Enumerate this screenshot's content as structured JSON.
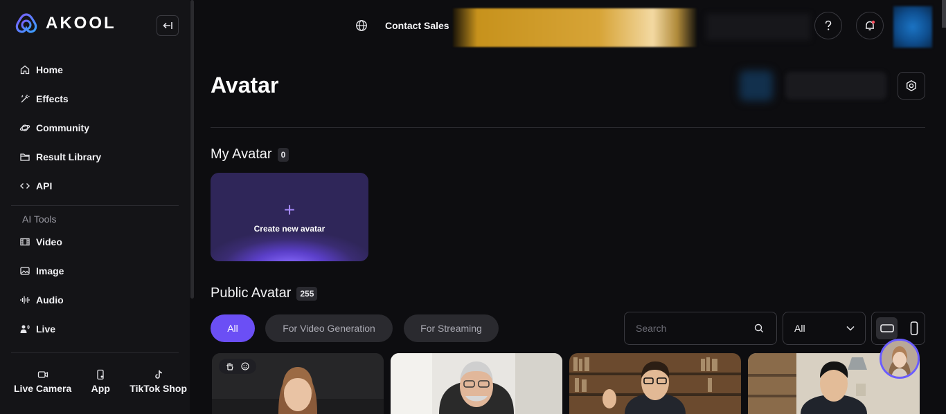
{
  "brand": {
    "name": "AKOOL"
  },
  "sidebar": {
    "nav": [
      {
        "label": "Home",
        "icon": "home-icon"
      },
      {
        "label": "Effects",
        "icon": "wand-icon"
      },
      {
        "label": "Community",
        "icon": "planet-icon"
      },
      {
        "label": "Result Library",
        "icon": "folder-icon"
      },
      {
        "label": "API",
        "icon": "code-icon"
      }
    ],
    "tools_label": "AI Tools",
    "tools": [
      {
        "label": "Video",
        "icon": "film-icon"
      },
      {
        "label": "Image",
        "icon": "image-icon"
      },
      {
        "label": "Audio",
        "icon": "waveform-icon"
      },
      {
        "label": "Live",
        "icon": "person-wave-icon"
      }
    ],
    "bottom": [
      {
        "label": "Live Camera",
        "icon": "camera-icon"
      },
      {
        "label": "App",
        "icon": "phone-icon"
      },
      {
        "label": "TikTok Shop",
        "icon": "tiktok-icon"
      }
    ]
  },
  "topbar": {
    "contact_label": "Contact Sales"
  },
  "page": {
    "title": "Avatar"
  },
  "my_avatar": {
    "title": "My Avatar",
    "count": "0",
    "create_label": "Create new avatar",
    "create_icon": "+"
  },
  "public_avatar": {
    "title": "Public Avatar",
    "count": "255",
    "filters": [
      "All",
      "For Video Generation",
      "For Streaming"
    ],
    "active_filter": "All",
    "search_placeholder": "Search",
    "select_value": "All"
  },
  "colors": {
    "accent": "#6b4ff5",
    "sidebar_bg": "#141417",
    "main_bg": "#0d0d10"
  }
}
